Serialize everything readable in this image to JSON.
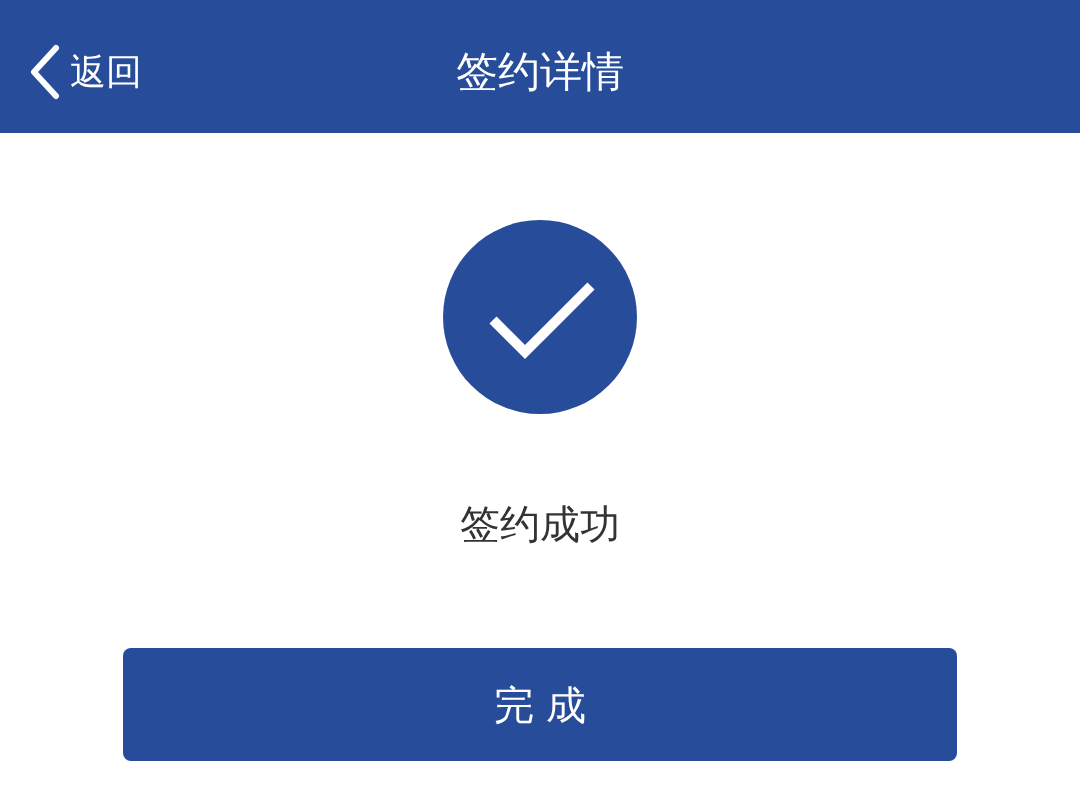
{
  "nav_bar": {
    "back_label": "返回",
    "title": "签约详情"
  },
  "result": {
    "kind": "success",
    "message": "签约成功"
  },
  "button": {
    "label": "完 成"
  }
}
